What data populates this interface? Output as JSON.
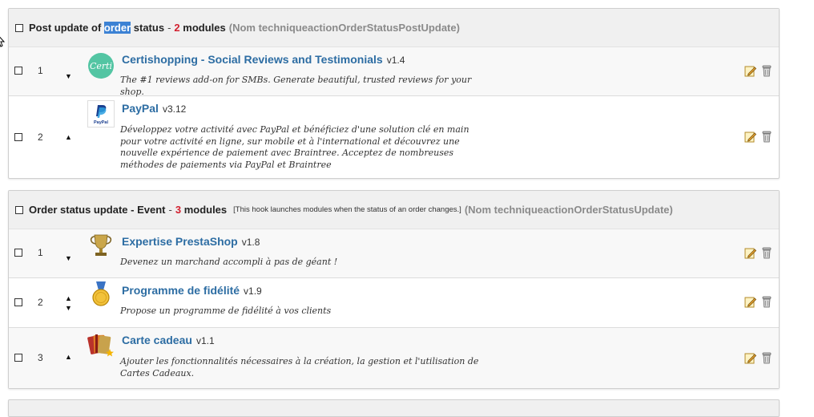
{
  "panels": [
    {
      "title_before": "Post update of",
      "title_highlight": "order",
      "title_after": "status",
      "sep": "-",
      "count": "2",
      "count_label": "modules",
      "description": "",
      "technical_name": "(Nom techniqueactionOrderStatusPostUpdate)",
      "modules": [
        {
          "position": "1",
          "name": "Certishopping - Social Reviews and Testimonials",
          "version": "v1.4",
          "description": "The #1 reviews add-on for SMBs. Generate beautiful, trusted reviews for your shop.",
          "icon": "certi-logo-icon",
          "arrows": "down"
        },
        {
          "position": "2",
          "name": "PayPal",
          "version": "v3.12",
          "description": "Développez votre activité avec PayPal et bénéficiez d'une solution clé en main pour votre activité en ligne, sur mobile et à l'international et découvrez une nouvelle expérience de paiement avec Braintree. Acceptez de nombreuses méthodes de paiements via PayPal et Braintree",
          "icon": "paypal-logo-icon",
          "icon_text": "PayPal",
          "arrows": "up"
        }
      ]
    },
    {
      "title_before": "Order status update - Event",
      "title_highlight": "",
      "title_after": "",
      "sep": "-",
      "count": "3",
      "count_label": "modules",
      "description": "[This hook launches modules when the status of an order changes.]",
      "technical_name": "(Nom techniqueactionOrderStatusUpdate)",
      "modules": [
        {
          "position": "1",
          "name": "Expertise PrestaShop",
          "version": "v1.8",
          "description": "Devenez un marchand accompli à pas de géant !",
          "icon": "trophy-icon",
          "arrows": "down"
        },
        {
          "position": "2",
          "name": "Programme de fidélité",
          "version": "v1.9",
          "description": "Propose un programme de fidélité à vos clients",
          "icon": "medal-icon",
          "arrows": "both"
        },
        {
          "position": "3",
          "name": "Carte cadeau",
          "version": "v1.1",
          "description": "Ajouter les fonctionnalités nécessaires à la création, la gestion et l'utilisation de Cartes Cadeaux.",
          "icon": "gift-cards-icon",
          "arrows": "up"
        }
      ]
    }
  ],
  "glyphs": {
    "arrow_up": "▲",
    "arrow_down": "▼"
  },
  "actions": {
    "edit": "edit-icon",
    "delete": "delete-icon"
  },
  "colors": {
    "module_name": "#2d6da3",
    "count": "#d2202f",
    "technical_name": "#8a8a8a",
    "highlight": "#3c82d4",
    "header_bg": "#f0f0f0"
  }
}
